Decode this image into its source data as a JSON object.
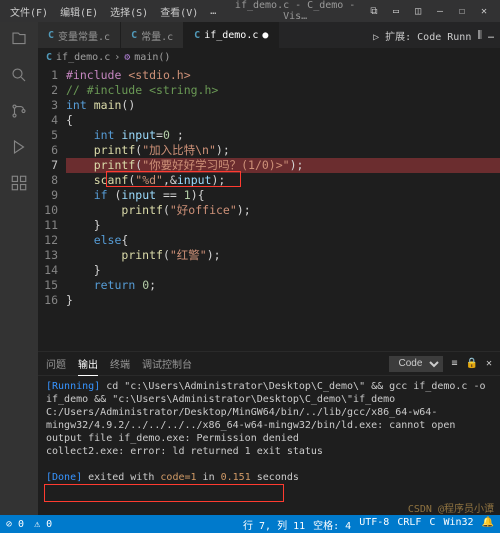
{
  "menubar": {
    "file": "文件(F)",
    "edit": "编辑(E)",
    "select": "选择(S)",
    "view": "查看(V)",
    "more": "…"
  },
  "window": {
    "title": "if_demo.c - C_demo - Vis…"
  },
  "activitybar": {
    "explorer": "explorer",
    "search": "search",
    "scm": "source-control",
    "debug": "run-debug",
    "extensions": "extensions"
  },
  "tabs": [
    {
      "icon": "C",
      "label": "变量常量.c",
      "active": false,
      "dirty": false
    },
    {
      "icon": "C",
      "label": "常量.c",
      "active": false,
      "dirty": false
    },
    {
      "icon": "C",
      "label": "if_demo.c",
      "active": true,
      "dirty": true
    }
  ],
  "tabs_right": {
    "run": "▷ 扩展: Code Runn",
    "split": "⫼",
    "more": "…"
  },
  "breadcrumb": {
    "file_icon": "C",
    "file": "if_demo.c",
    "sep": "›",
    "symbol_icon": "⚙",
    "symbol": "main()"
  },
  "code": {
    "lines": [
      {
        "n": 1,
        "segs": [
          [
            "pre",
            "#include"
          ],
          [
            "pl",
            " "
          ],
          [
            "str",
            "<stdio.h>"
          ]
        ]
      },
      {
        "n": 2,
        "segs": [
          [
            "com",
            "// #include <string.h>"
          ]
        ]
      },
      {
        "n": 3,
        "segs": [
          [
            "kw",
            "int"
          ],
          [
            "pl",
            " "
          ],
          [
            "fn",
            "main"
          ],
          [
            "pl",
            "()"
          ]
        ]
      },
      {
        "n": 4,
        "segs": [
          [
            "pl",
            "{"
          ]
        ]
      },
      {
        "n": 5,
        "segs": [
          [
            "pl",
            "    "
          ],
          [
            "kw",
            "int"
          ],
          [
            "pl",
            " "
          ],
          [
            "id",
            "input"
          ],
          [
            "op",
            "="
          ],
          [
            "num",
            "0"
          ],
          [
            "pl",
            " ;"
          ]
        ]
      },
      {
        "n": 6,
        "segs": [
          [
            "pl",
            "    "
          ],
          [
            "fn",
            "printf"
          ],
          [
            "pl",
            "("
          ],
          [
            "str",
            "\"加入比特\\n\""
          ],
          [
            "pl",
            ");"
          ]
        ]
      },
      {
        "n": 7,
        "segs": [
          [
            "pl",
            "    "
          ],
          [
            "fn",
            "printf"
          ],
          [
            "pl",
            "("
          ],
          [
            "str",
            "\"你要好好学习吗？(1/0)>\""
          ],
          [
            "pl",
            ");"
          ]
        ],
        "current": true,
        "hl": true
      },
      {
        "n": 8,
        "segs": [
          [
            "pl",
            "    "
          ],
          [
            "fn",
            "scanf"
          ],
          [
            "pl",
            "("
          ],
          [
            "str",
            "\"%d\""
          ],
          [
            "pl",
            ","
          ],
          [
            "op",
            "&"
          ],
          [
            "id",
            "input"
          ],
          [
            "pl",
            ");"
          ]
        ]
      },
      {
        "n": 9,
        "segs": [
          [
            "pl",
            "    "
          ],
          [
            "kw",
            "if"
          ],
          [
            "pl",
            " ("
          ],
          [
            "id",
            "input"
          ],
          [
            "pl",
            " "
          ],
          [
            "op",
            "=="
          ],
          [
            "pl",
            " "
          ],
          [
            "num",
            "1"
          ],
          [
            "pl",
            ")"
          ],
          [
            "pl",
            "{"
          ]
        ]
      },
      {
        "n": 10,
        "segs": [
          [
            "pl",
            "        "
          ],
          [
            "fn",
            "printf"
          ],
          [
            "pl",
            "("
          ],
          [
            "str",
            "\"好office\""
          ],
          [
            "pl",
            ");"
          ]
        ]
      },
      {
        "n": 11,
        "segs": [
          [
            "pl",
            "    }"
          ]
        ]
      },
      {
        "n": 12,
        "segs": [
          [
            "pl",
            "    "
          ],
          [
            "kw",
            "else"
          ],
          [
            "pl",
            "{"
          ]
        ]
      },
      {
        "n": 13,
        "segs": [
          [
            "pl",
            "        "
          ],
          [
            "fn",
            "printf"
          ],
          [
            "pl",
            "("
          ],
          [
            "str",
            "\"红警\""
          ],
          [
            "pl",
            ");"
          ]
        ]
      },
      {
        "n": 14,
        "segs": [
          [
            "pl",
            "    }"
          ]
        ]
      },
      {
        "n": 15,
        "segs": [
          [
            "pl",
            "    "
          ],
          [
            "kw",
            "return"
          ],
          [
            "pl",
            " "
          ],
          [
            "num",
            "0"
          ],
          [
            "pl",
            ";"
          ]
        ]
      },
      {
        "n": 16,
        "segs": [
          [
            "pl",
            "}"
          ]
        ]
      }
    ]
  },
  "panel": {
    "tabs": {
      "problems": "问题",
      "output": "输出",
      "terminal": "终端",
      "debug": "调试控制台"
    },
    "select": "Code",
    "icons": {
      "clear": "≡",
      "lock": "🔒",
      "close": "✕"
    }
  },
  "output": {
    "running_label": "[Running]",
    "l1": " cd \"c:\\Users\\Administrator\\Desktop\\C_demo\\\" && gcc if_demo.c -o if_demo && \"c:\\Users\\Administrator\\Desktop\\C_demo\\\"if_demo",
    "l2": "C:/Users/Administrator/Desktop/MinGW64/bin/../lib/gcc/x86_64-w64-mingw32/4.9.2/../../../../x86_64-w64-mingw32/bin/ld.exe: cannot open output file if_demo.exe: Permission denied",
    "l3": "collect2.exe: error: ld returned 1 exit status",
    "done_label": "[Done]",
    "done_text1": " exited with ",
    "done_code": "code=1",
    "done_text2": " in ",
    "done_time": "0.151",
    "done_text3": " seconds"
  },
  "statusbar": {
    "errors": "⊘ 0",
    "warnings": "⚠ 0",
    "cursor": "行 7, 列 11",
    "spaces": "空格: 4",
    "encoding": "UTF-8",
    "eol": "CRLF",
    "lang": "C",
    "win": "Win32",
    "bell": "🔔"
  },
  "watermark": "CSDN @程序员小谭"
}
